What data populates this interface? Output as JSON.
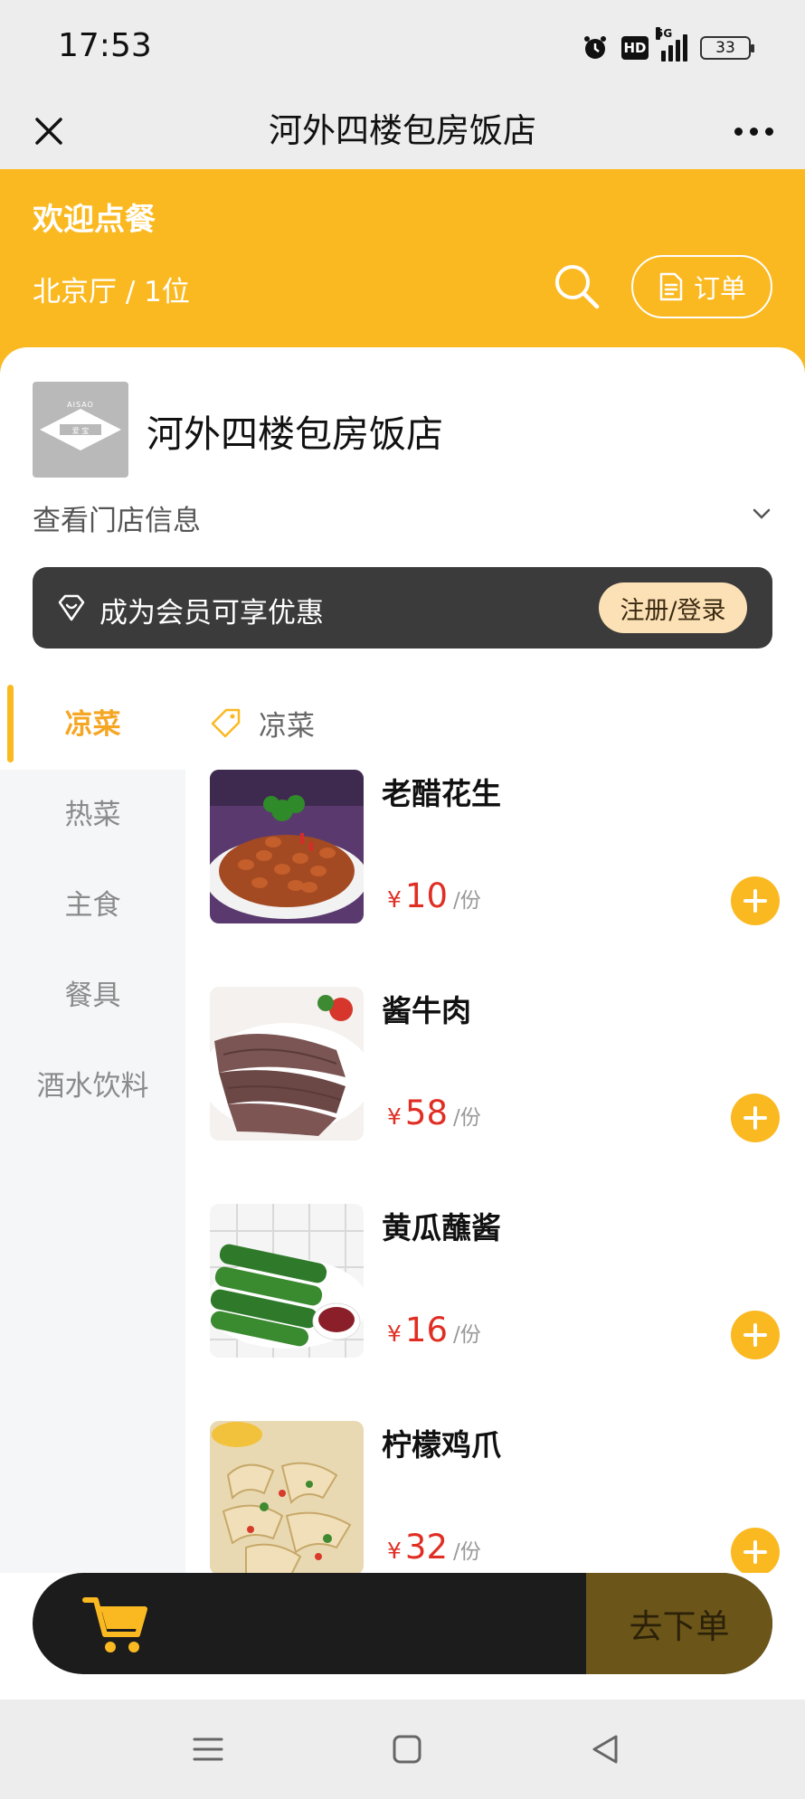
{
  "status": {
    "time": "17:53",
    "hd": "HD",
    "network": "5G",
    "battery": "33"
  },
  "titlebar": {
    "title": "河外四楼包房饭店"
  },
  "header": {
    "welcome": "欢迎点餐",
    "table_info": "北京厅 / 1位",
    "order_label": "订单"
  },
  "store": {
    "name": "河外四楼包房饭店",
    "info_label": "查看门店信息",
    "logo_text": "AISAO",
    "logo_sub": "爱 宝"
  },
  "member": {
    "text": "成为会员可享优惠",
    "button": "注册/登录"
  },
  "categories": [
    {
      "label": "凉菜",
      "active": true
    },
    {
      "label": "热菜",
      "active": false
    },
    {
      "label": "主食",
      "active": false
    },
    {
      "label": "餐具",
      "active": false
    },
    {
      "label": "酒水饮料",
      "active": false
    }
  ],
  "current_category": "凉菜",
  "dishes": [
    {
      "name": "老醋花生",
      "currency": "¥",
      "price": "10",
      "unit": "/份"
    },
    {
      "name": "酱牛肉",
      "currency": "¥",
      "price": "58",
      "unit": "/份"
    },
    {
      "name": "黄瓜蘸酱",
      "currency": "¥",
      "price": "16",
      "unit": "/份"
    },
    {
      "name": "柠檬鸡爪",
      "currency": "¥",
      "price": "32",
      "unit": "/份"
    }
  ],
  "cart": {
    "checkout_label": "去下单"
  },
  "colors": {
    "accent": "#fbb921",
    "price": "#e02e24",
    "dark": "#1c1c1c"
  }
}
